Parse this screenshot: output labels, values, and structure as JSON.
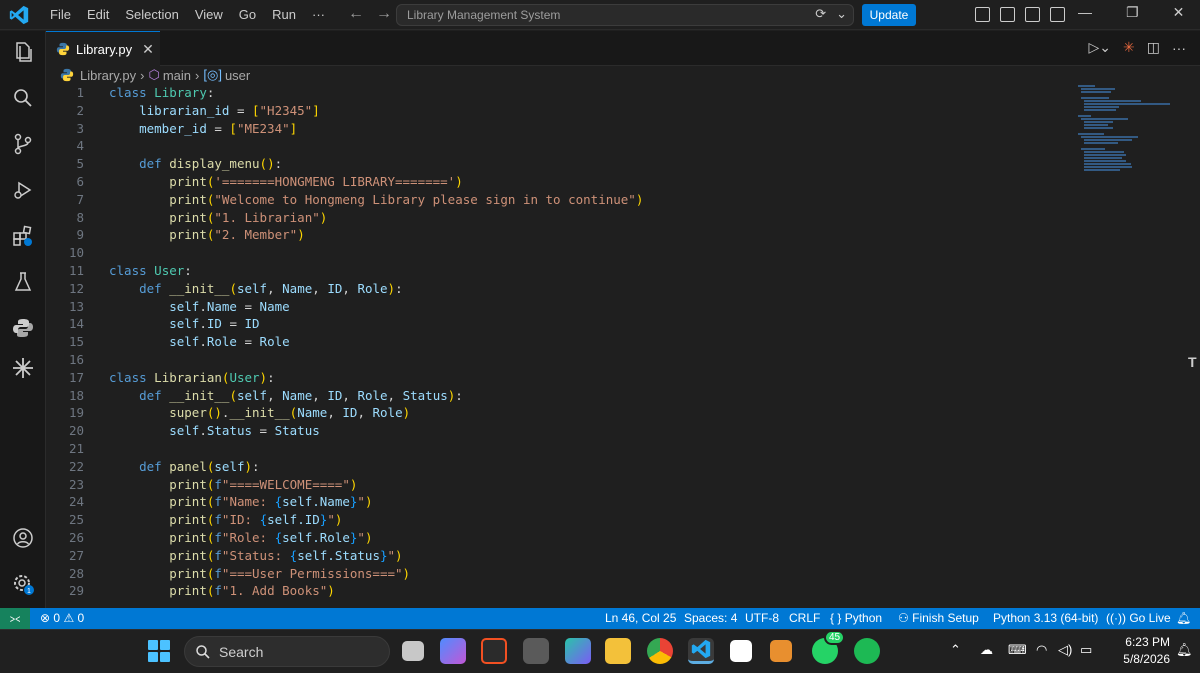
{
  "menu": [
    "File",
    "Edit",
    "Selection",
    "View",
    "Go",
    "Run",
    "···"
  ],
  "command_center": {
    "text": "Library Management System"
  },
  "update_label": "Update",
  "tab": {
    "label": "Library.py"
  },
  "breadcrumb": {
    "file": "Library.py",
    "symbol1": "main",
    "symbol2": "user"
  },
  "code": [
    {
      "n": "1",
      "t": "class Library:"
    },
    {
      "n": "2",
      "t": "    librarian_id = [\"H2345\"]"
    },
    {
      "n": "3",
      "t": "    member_id = [\"ME234\"]"
    },
    {
      "n": "4",
      "t": ""
    },
    {
      "n": "5",
      "t": "    def display_menu():"
    },
    {
      "n": "6",
      "t": "        print('=======HONGMENG LIBRARY=======')"
    },
    {
      "n": "7",
      "t": "        print(\"Welcome to Hongmeng Library please sign in to continue\")"
    },
    {
      "n": "8",
      "t": "        print(\"1. Librarian\")"
    },
    {
      "n": "9",
      "t": "        print(\"2. Member\")"
    },
    {
      "n": "10",
      "t": ""
    },
    {
      "n": "11",
      "t": "class User:"
    },
    {
      "n": "12",
      "t": "    def __init__(self, Name, ID, Role):"
    },
    {
      "n": "13",
      "t": "        self.Name = Name"
    },
    {
      "n": "14",
      "t": "        self.ID = ID"
    },
    {
      "n": "15",
      "t": "        self.Role = Role"
    },
    {
      "n": "16",
      "t": ""
    },
    {
      "n": "17",
      "t": "class Librarian(User):"
    },
    {
      "n": "18",
      "t": "    def __init__(self, Name, ID, Role, Status):"
    },
    {
      "n": "19",
      "t": "        super().__init__(Name, ID, Role)"
    },
    {
      "n": "20",
      "t": "        self.Status = Status"
    },
    {
      "n": "21",
      "t": ""
    },
    {
      "n": "22",
      "t": "    def panel(self):"
    },
    {
      "n": "23",
      "t": "        print(f\"====WELCOME====\")"
    },
    {
      "n": "24",
      "t": "        print(f\"Name: {self.Name}\")"
    },
    {
      "n": "25",
      "t": "        print(f\"ID: {self.ID}\")"
    },
    {
      "n": "26",
      "t": "        print(f\"Role: {self.Role}\")"
    },
    {
      "n": "27",
      "t": "        print(f\"Status: {self.Status}\")"
    },
    {
      "n": "28",
      "t": "        print(f\"===User Permissions===\")"
    },
    {
      "n": "29",
      "t": "        print(f\"1. Add Books\")"
    }
  ],
  "status": {
    "errors": "0",
    "warnings": "0",
    "position": "Ln 46, Col 25",
    "spaces": "Spaces: 4",
    "encoding": "UTF-8",
    "eol": "CRLF",
    "language": "Python",
    "finish_setup": "Finish Setup",
    "interpreter": "Python 3.13 (64-bit)",
    "golive": "Go Live"
  },
  "taskbar": {
    "search": "Search",
    "whatsapp_badge": "45",
    "time": "6:23 PM",
    "date": "5/8/2026",
    "settings_badge": "1"
  },
  "colors": {
    "accent": "#0078d4",
    "editor_bg": "#1f1f1f",
    "remote": "#16825d"
  }
}
